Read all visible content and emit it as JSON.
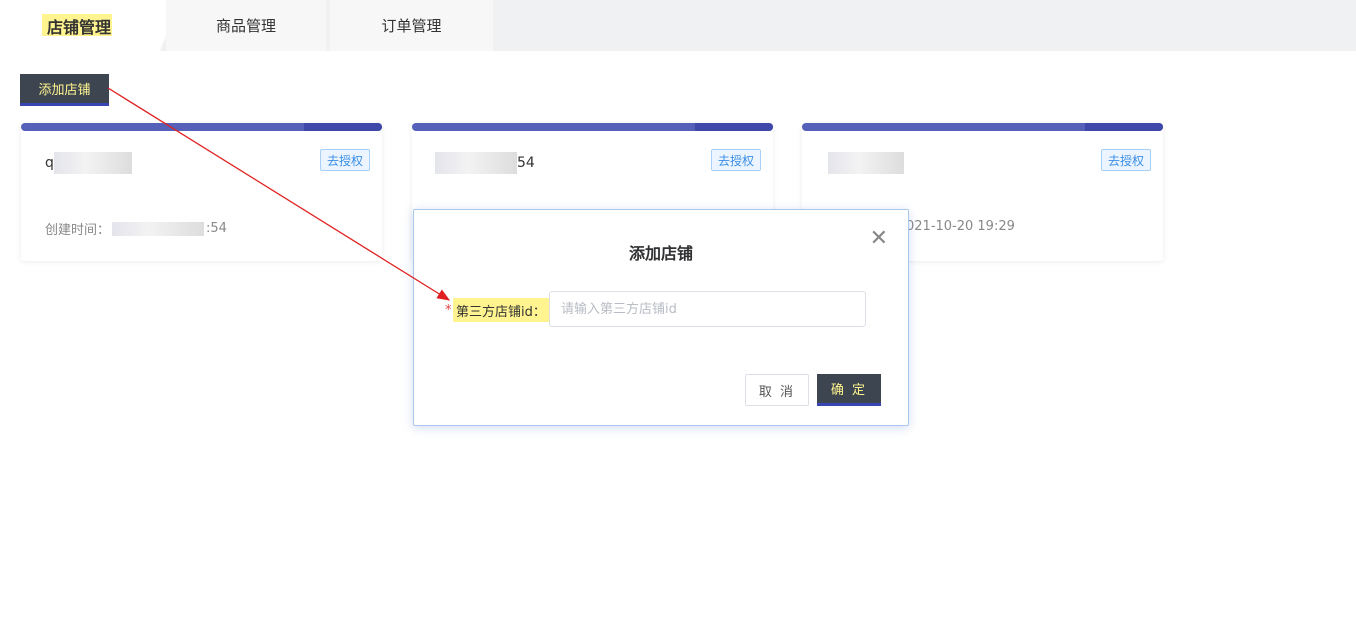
{
  "tabs": [
    {
      "label": "店铺管理",
      "active": true
    },
    {
      "label": "商品管理",
      "active": false
    },
    {
      "label": "订单管理",
      "active": false
    }
  ],
  "toolbar": {
    "add_shop_label": "添加店铺"
  },
  "cards": [
    {
      "name_prefix": "q",
      "name_suffix": "",
      "auth_label": "去授权",
      "created_label": "创建时间：",
      "created_suffix": ":54"
    },
    {
      "name_prefix": "",
      "name_suffix": "54",
      "auth_label": "去授权",
      "created_label": "",
      "created_suffix": ""
    },
    {
      "name_prefix": "",
      "name_suffix": "",
      "auth_label": "去授权",
      "created_label": "",
      "created_suffix": "021-10-20 19:29"
    }
  ],
  "dialog": {
    "title": "添加店铺",
    "required_mark": "*",
    "field_label": "第三方店铺id：",
    "field_placeholder": "请输入第三方店铺id",
    "field_value": "",
    "cancel_label": "取 消",
    "ok_label": "确 定"
  },
  "colors": {
    "highlight": "#fff48f",
    "primary_dark": "#3d4650",
    "card_bar": "#5561b9",
    "annotation_arrow": "#e02020"
  }
}
